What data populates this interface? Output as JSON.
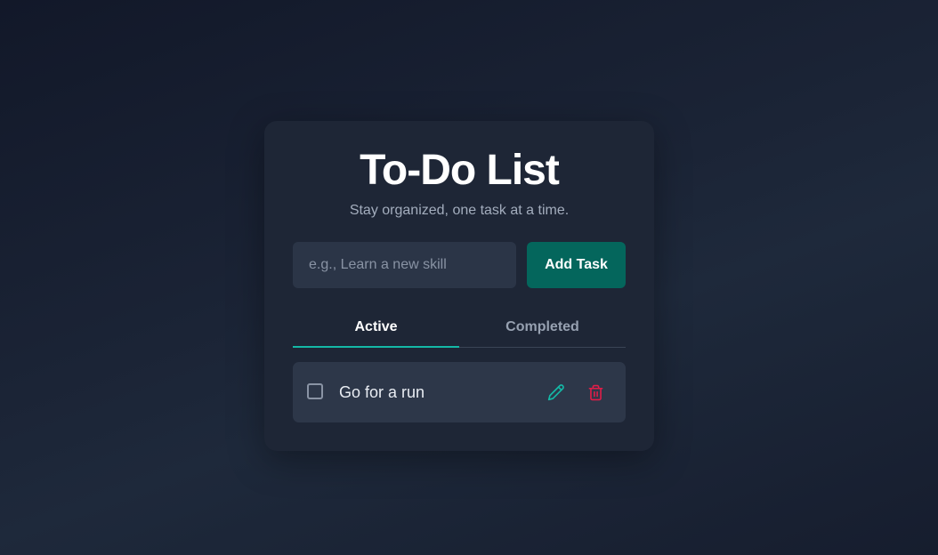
{
  "header": {
    "title": "To-Do List",
    "subtitle": "Stay organized, one task at a time."
  },
  "add_form": {
    "placeholder": "e.g., Learn a new skill",
    "value": "",
    "button_label": "Add Task"
  },
  "tabs": [
    {
      "label": "Active",
      "selected": true
    },
    {
      "label": "Completed",
      "selected": false
    }
  ],
  "tasks": [
    {
      "text": "Go for a run",
      "completed": false,
      "edit_icon": "pencil-icon",
      "delete_icon": "trash-icon"
    }
  ],
  "colors": {
    "accent": "#14b8a6",
    "add_button": "#04665c",
    "edit_icon": "#14b8a6",
    "delete_icon": "#e11d48",
    "card_bg": "#1e2636"
  }
}
